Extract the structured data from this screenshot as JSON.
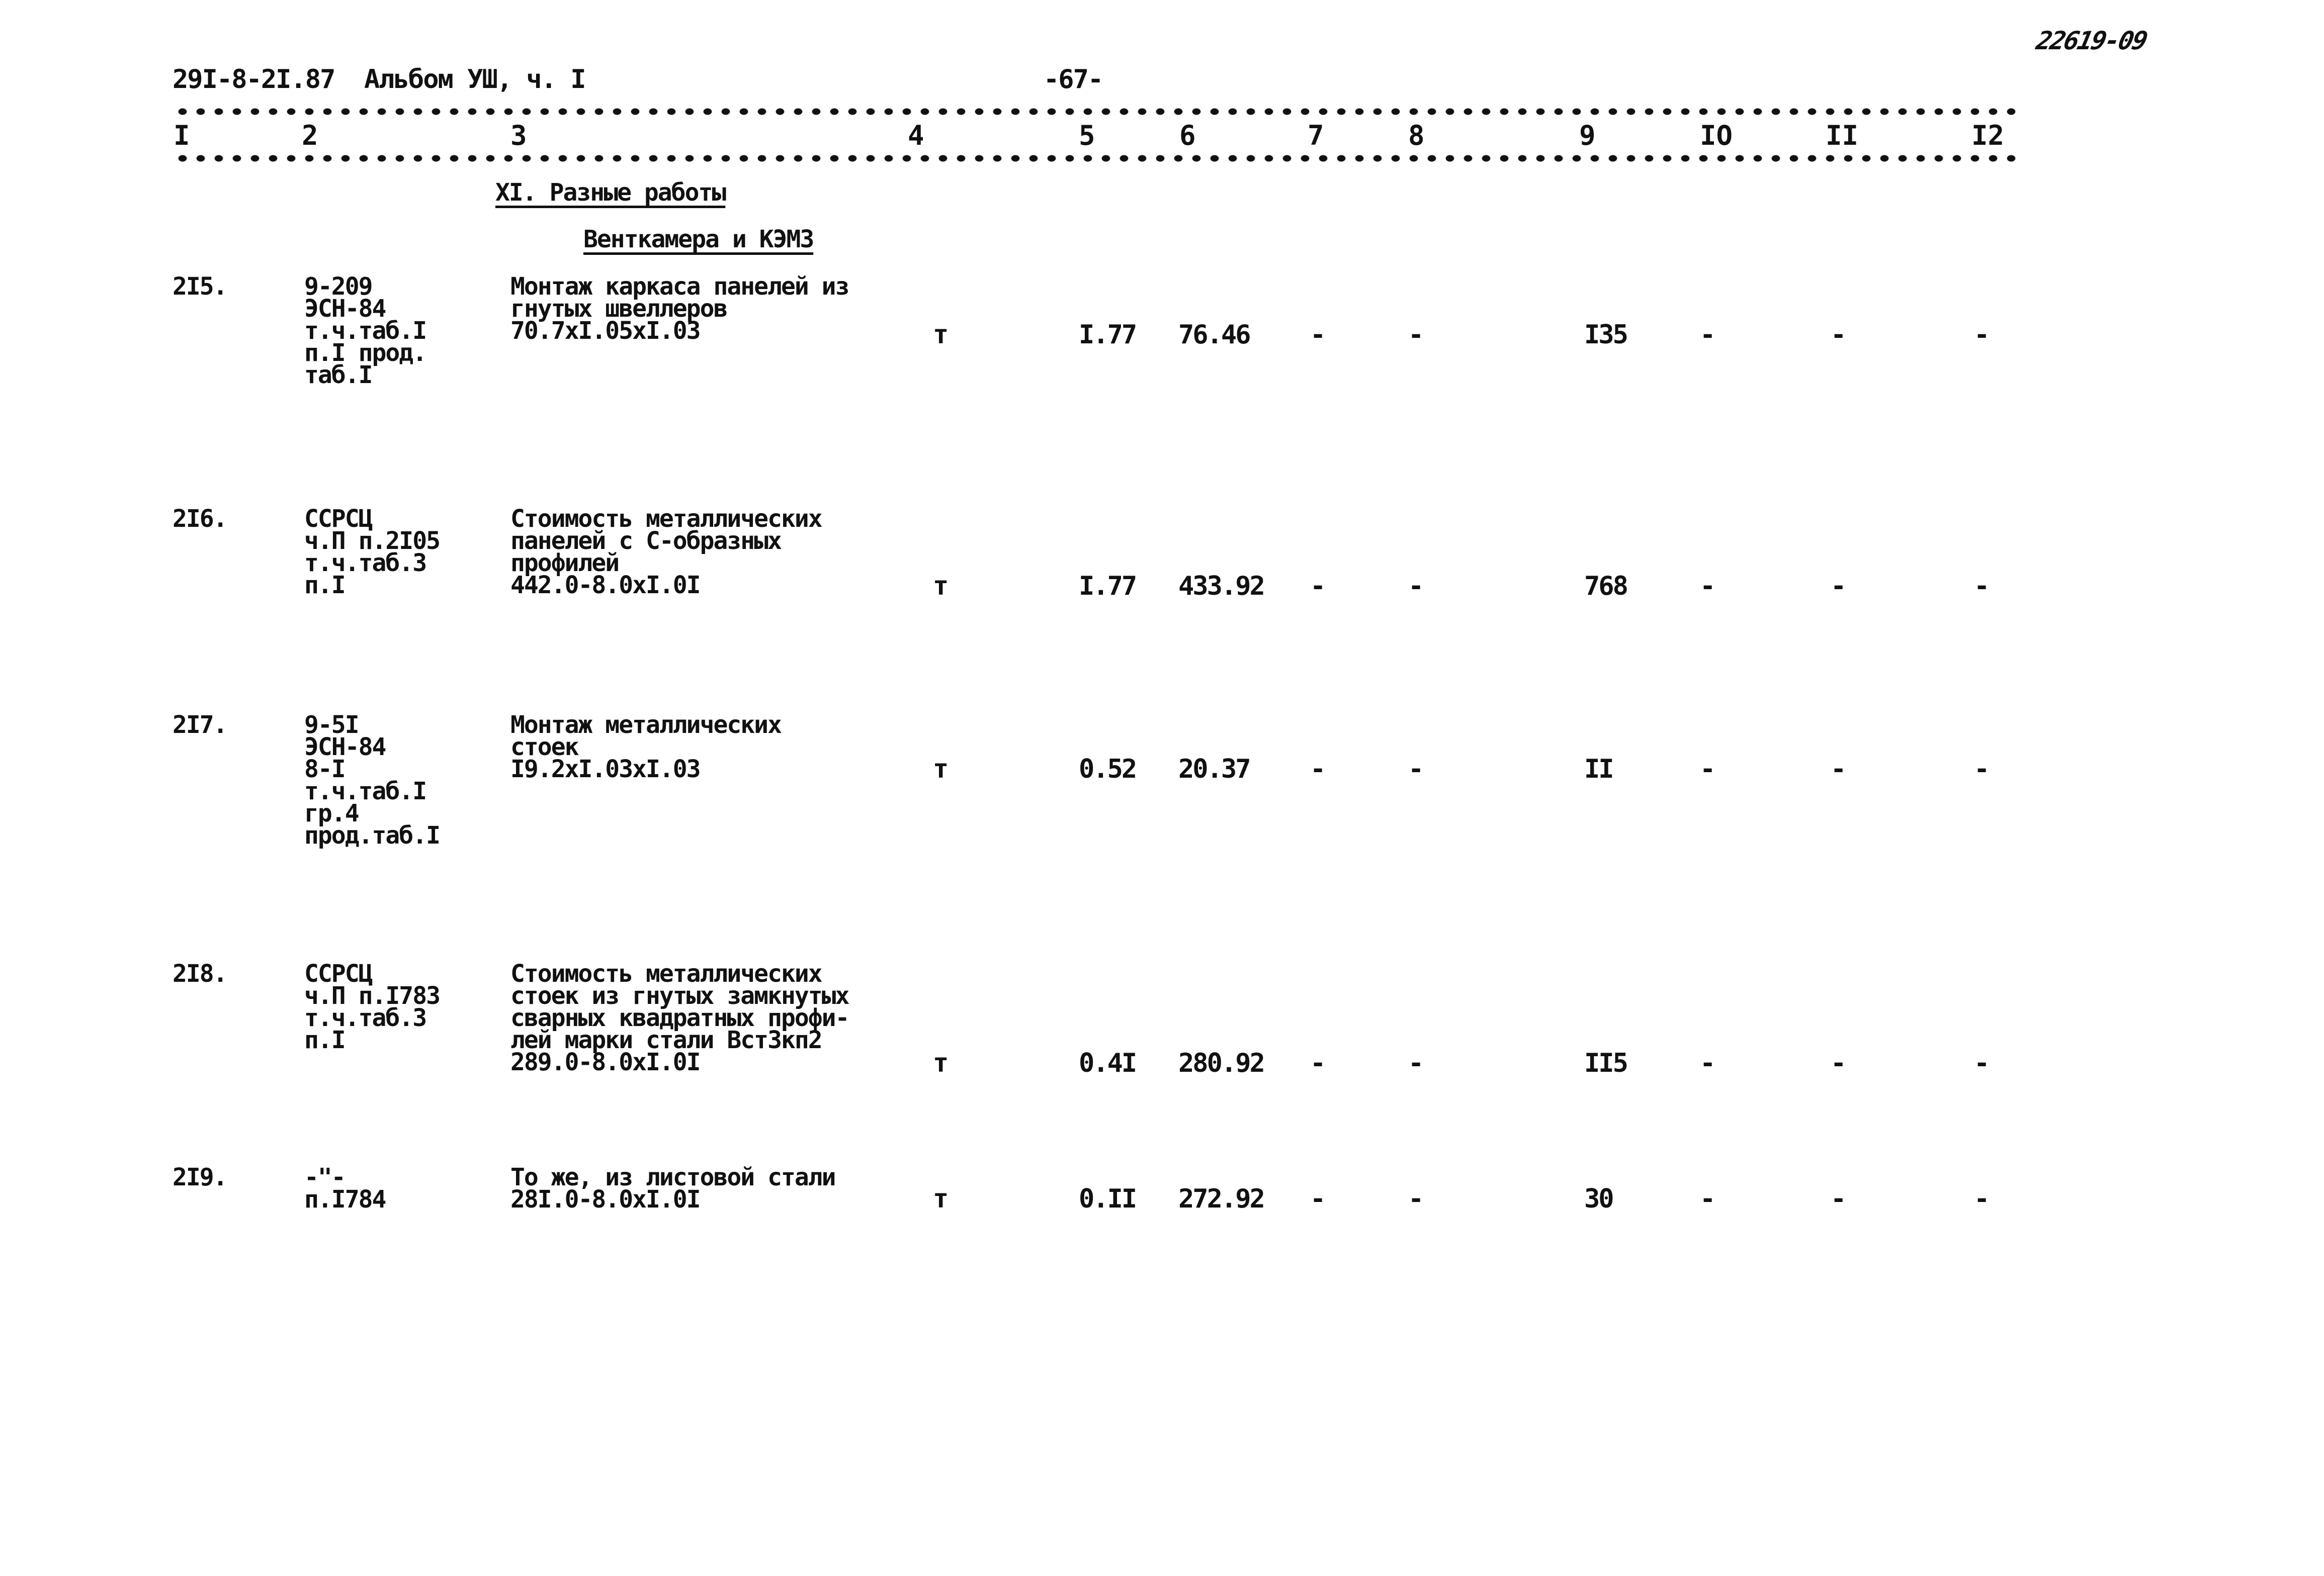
{
  "header": {
    "doc_ref": "29I-8-2I.87  Альбом УШ, ч. I",
    "page_number": "-67-",
    "stamp": "22619-09"
  },
  "columns": [
    "I",
    "2",
    "3",
    "4",
    "5",
    "6",
    "7",
    "8",
    "9",
    "IO",
    "II",
    "I2"
  ],
  "section": {
    "title": "XI. Разные работы",
    "subtitle": "Венткамера и КЭМЗ"
  },
  "rows": [
    {
      "no": "2I5.",
      "code": "9-209\nЭСН-84\nт.ч.таб.I\nп.I прод.\nтаб.I",
      "description": "Монтаж каркаса панелей из\nгнутых швеллеров\n70.7xI.05xI.03",
      "unit": "т",
      "qty": "I.77",
      "price": "76.46",
      "c7": "-",
      "c8": "-",
      "c9": "I35",
      "c10": "-",
      "c11": "-",
      "c12": "-"
    },
    {
      "no": "2I6.",
      "code": "ССРСЦ\nч.П п.2I05\nт.ч.таб.3\nп.I",
      "description": "Стоимость металлических\nпанелей с С-образных\nпрофилей\n442.0-8.0xI.0I",
      "unit": "т",
      "qty": "I.77",
      "price": "433.92",
      "c7": "-",
      "c8": "-",
      "c9": "768",
      "c10": "-",
      "c11": "-",
      "c12": "-"
    },
    {
      "no": "2I7.",
      "code": "9-5I\nЭСН-84\n8-I\nт.ч.таб.I\nгр.4\nпрод.таб.I",
      "description": "Монтаж металлических\nстоек\nI9.2xI.03xI.03",
      "unit": "т",
      "qty": "0.52",
      "price": "20.37",
      "c7": "-",
      "c8": "-",
      "c9": "II",
      "c10": "-",
      "c11": "-",
      "c12": "-"
    },
    {
      "no": "2I8.",
      "code": "ССРСЦ\nч.П п.I783\nт.ч.таб.3\nп.I",
      "description": "Стоимость металлических\nстоек из гнутых замкнутых\nсварных квадратных профи-\nлей марки стали Вст3кп2\n289.0-8.0xI.0I",
      "unit": "т",
      "qty": "0.4I",
      "price": "280.92",
      "c7": "-",
      "c8": "-",
      "c9": "II5",
      "c10": "-",
      "c11": "-",
      "c12": "-"
    },
    {
      "no": "2I9.",
      "code": "-\"-\nп.I784",
      "description": "То же, из листовой стали\n28I.0-8.0xI.0I",
      "unit": "т",
      "qty": "0.II",
      "price": "272.92",
      "c7": "-",
      "c8": "-",
      "c9": "30",
      "c10": "-",
      "c11": "-",
      "c12": "-"
    }
  ]
}
